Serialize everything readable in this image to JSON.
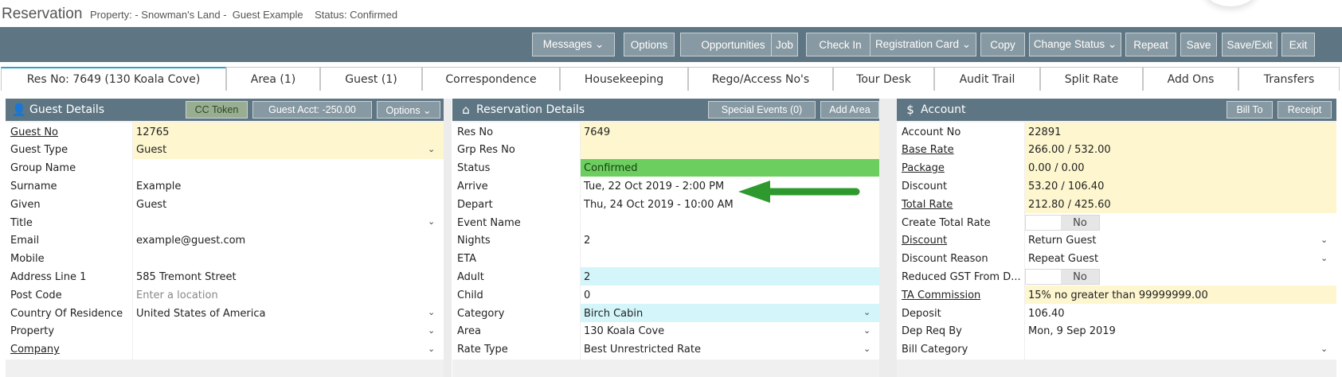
{
  "header": {
    "title": "Reservation",
    "meta": "Property: - Snowman's Land -  Guest Example    Status: Confirmed"
  },
  "toolbar": {
    "buttons": [
      {
        "label": "Messages ⌄",
        "name": "messages-button"
      },
      {
        "label": "Options",
        "name": "options-button"
      },
      {
        "label": "Opportunities",
        "name": "opportunities-button"
      },
      {
        "label": "Job",
        "name": "job-button"
      },
      {
        "label": "Check In",
        "name": "check-in-button"
      },
      {
        "label": "Registration Card ⌄",
        "name": "registration-card-button"
      },
      {
        "label": "Copy",
        "name": "copy-button"
      },
      {
        "label": "Change Status ⌄",
        "name": "change-status-button"
      },
      {
        "label": "Repeat",
        "name": "repeat-button"
      },
      {
        "label": "Save",
        "name": "save-button"
      },
      {
        "label": "Save/Exit",
        "name": "save-exit-button"
      },
      {
        "label": "Exit",
        "name": "exit-button"
      }
    ]
  },
  "tabs": [
    "Res No: 7649 (130 Koala Cove)",
    "Area (1)",
    "Guest (1)",
    "Correspondence",
    "Housekeeping",
    "Rego/Access No's",
    "Tour Desk",
    "Audit Trail",
    "Split Rate",
    "Add Ons",
    "Transfers"
  ],
  "guest": {
    "title": "Guest Details",
    "icon": "user-icon",
    "buttons": [
      "CC Token",
      "Guest Acct: -250.00",
      "Options ⌄"
    ],
    "rows": [
      {
        "label": "Guest No",
        "value": "12765",
        "link": true,
        "style": "yellow"
      },
      {
        "label": "Guest Type",
        "value": "Guest",
        "style": "yellow",
        "dropdown": true
      },
      {
        "label": "Group Name",
        "value": ""
      },
      {
        "label": "Surname",
        "value": "Example"
      },
      {
        "label": "Given",
        "value": "Guest"
      },
      {
        "label": "Title",
        "value": "",
        "dropdown": true
      },
      {
        "label": "Email",
        "value": "example@guest.com"
      },
      {
        "label": "Mobile",
        "value": ""
      },
      {
        "label": "Address Line 1",
        "value": "585 Tremont Street"
      },
      {
        "label": "Post Code",
        "value": "",
        "placeholder": "Enter a location"
      },
      {
        "label": "Country Of Residence",
        "value": "United States of America",
        "dropdown": true
      },
      {
        "label": "Property",
        "value": "",
        "dropdown": true
      },
      {
        "label": "Company",
        "value": "",
        "link": true,
        "dropdown": true
      }
    ]
  },
  "reservation": {
    "title": "Reservation Details",
    "icon": "home-icon",
    "buttons": [
      "Special Events (0)",
      "Add Area"
    ],
    "rows": [
      {
        "label": "Res No",
        "value": "7649",
        "style": "yellow"
      },
      {
        "label": "Grp Res No",
        "value": "",
        "style": "yellow"
      },
      {
        "label": "Status",
        "value": "Confirmed",
        "style": "green"
      },
      {
        "label": "Arrive",
        "value": "Tue, 22 Oct 2019 - 2:00 PM"
      },
      {
        "label": "Depart",
        "value": "Thu, 24 Oct 2019 - 10:00 AM"
      },
      {
        "label": "Event Name",
        "value": ""
      },
      {
        "label": "Nights",
        "value": "2"
      },
      {
        "label": "ETA",
        "value": ""
      },
      {
        "label": "Adult",
        "value": "2",
        "style": "cyan"
      },
      {
        "label": "Child",
        "value": "0"
      },
      {
        "label": "Category",
        "value": "Birch Cabin",
        "style": "cyan",
        "dropdown": true
      },
      {
        "label": "Area",
        "value": "130 Koala Cove",
        "dropdown": true
      },
      {
        "label": "Rate Type",
        "value": "Best Unrestricted Rate",
        "dropdown": true
      }
    ]
  },
  "account": {
    "title": "Account",
    "icon": "dollar-icon",
    "buttons": [
      "Bill To",
      "Receipt"
    ],
    "rows": [
      {
        "label": "Account No",
        "value": "22891",
        "style": "yellow"
      },
      {
        "label": "Base Rate",
        "value": "266.00 / 532.00",
        "link": true,
        "style": "yellow"
      },
      {
        "label": "Package",
        "value": "0.00 / 0.00",
        "link": true,
        "style": "yellow"
      },
      {
        "label": "Discount",
        "value": "53.20 / 106.40",
        "style": "yellow"
      },
      {
        "label": "Total Rate",
        "value": "212.80 / 425.60",
        "link": true,
        "style": "yellow"
      },
      {
        "label": "Create Total Rate",
        "toggle": "No"
      },
      {
        "label": "Discount",
        "value": "Return Guest",
        "link": true,
        "dropdown": true
      },
      {
        "label": "Discount Reason",
        "value": "Repeat Guest",
        "dropdown": true
      },
      {
        "label": "Reduced GST From D...",
        "toggle": "No"
      },
      {
        "label": "TA Commission",
        "value": "15% no greater than 99999999.00",
        "link": true,
        "style": "yellow"
      },
      {
        "label": "Deposit",
        "value": "106.40"
      },
      {
        "label": "Dep Req By",
        "value": "Mon, 9 Sep 2019"
      },
      {
        "label": "Bill Category",
        "value": "",
        "dropdown": true
      }
    ]
  },
  "colors": {
    "toolbar": "#5e7683",
    "button": "#8799a2",
    "status_green": "#6cce5f",
    "arrow": "#2e9a2e"
  }
}
